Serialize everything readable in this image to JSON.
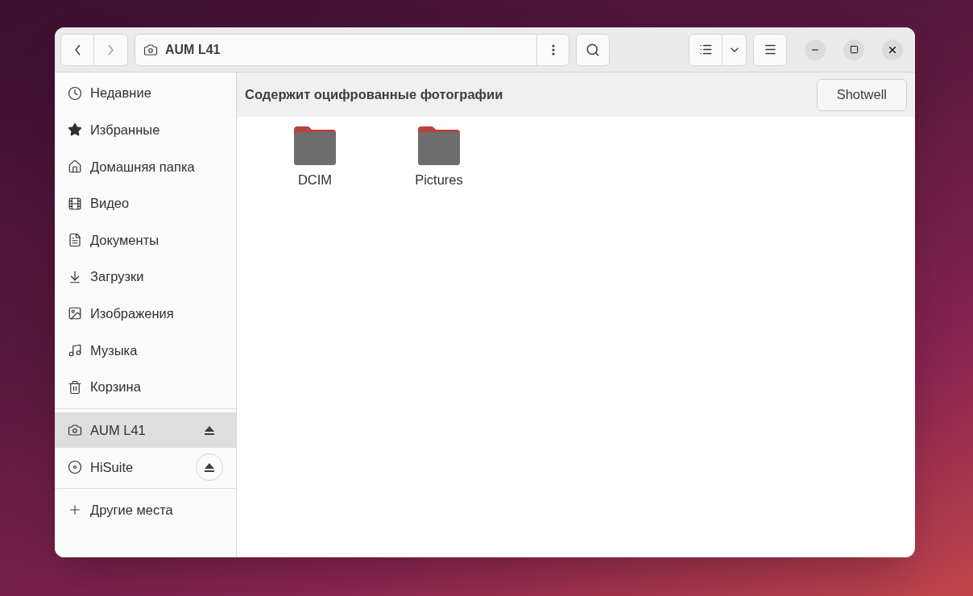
{
  "header": {
    "location": "AUM L41"
  },
  "sidebar": {
    "places": [
      {
        "label": "Недавние"
      },
      {
        "label": "Избранные"
      },
      {
        "label": "Домашняя папка"
      },
      {
        "label": "Видео"
      },
      {
        "label": "Документы"
      },
      {
        "label": "Загрузки"
      },
      {
        "label": "Изображения"
      },
      {
        "label": "Музыка"
      },
      {
        "label": "Корзина"
      }
    ],
    "devices": [
      {
        "label": "AUM L41",
        "selected": true,
        "eject_hovered": false
      },
      {
        "label": "HiSuite",
        "selected": false,
        "eject_hovered": true
      }
    ],
    "other": {
      "label": "Другие места"
    }
  },
  "info_bar": {
    "text": "Содержит оцифрованные фотографии",
    "button": "Shotwell"
  },
  "files": [
    {
      "name": "DCIM"
    },
    {
      "name": "Pictures"
    }
  ]
}
